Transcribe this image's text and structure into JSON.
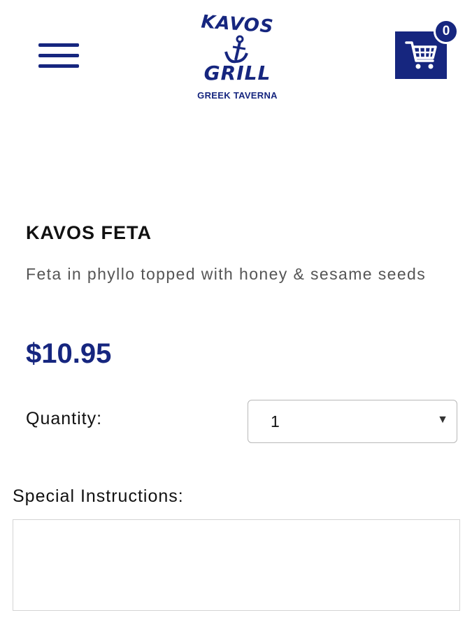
{
  "header": {
    "menu_icon": "hamburger-menu-icon",
    "logo": {
      "line1": "KAVOS",
      "line2": "GRILL",
      "tagline": "GREEK TAVERNA",
      "icon": "anchor-icon"
    },
    "cart": {
      "icon": "shopping-cart-icon",
      "count": "0"
    },
    "brand_color": "#16267f"
  },
  "product": {
    "name": "KAVOS FETA",
    "description": "Feta in phyllo topped with honey & sesame seeds",
    "price": "$10.95"
  },
  "order": {
    "quantity_label": "Quantity:",
    "quantity_value": "1",
    "special_instructions_label": "Special Instructions:",
    "special_instructions_value": ""
  }
}
